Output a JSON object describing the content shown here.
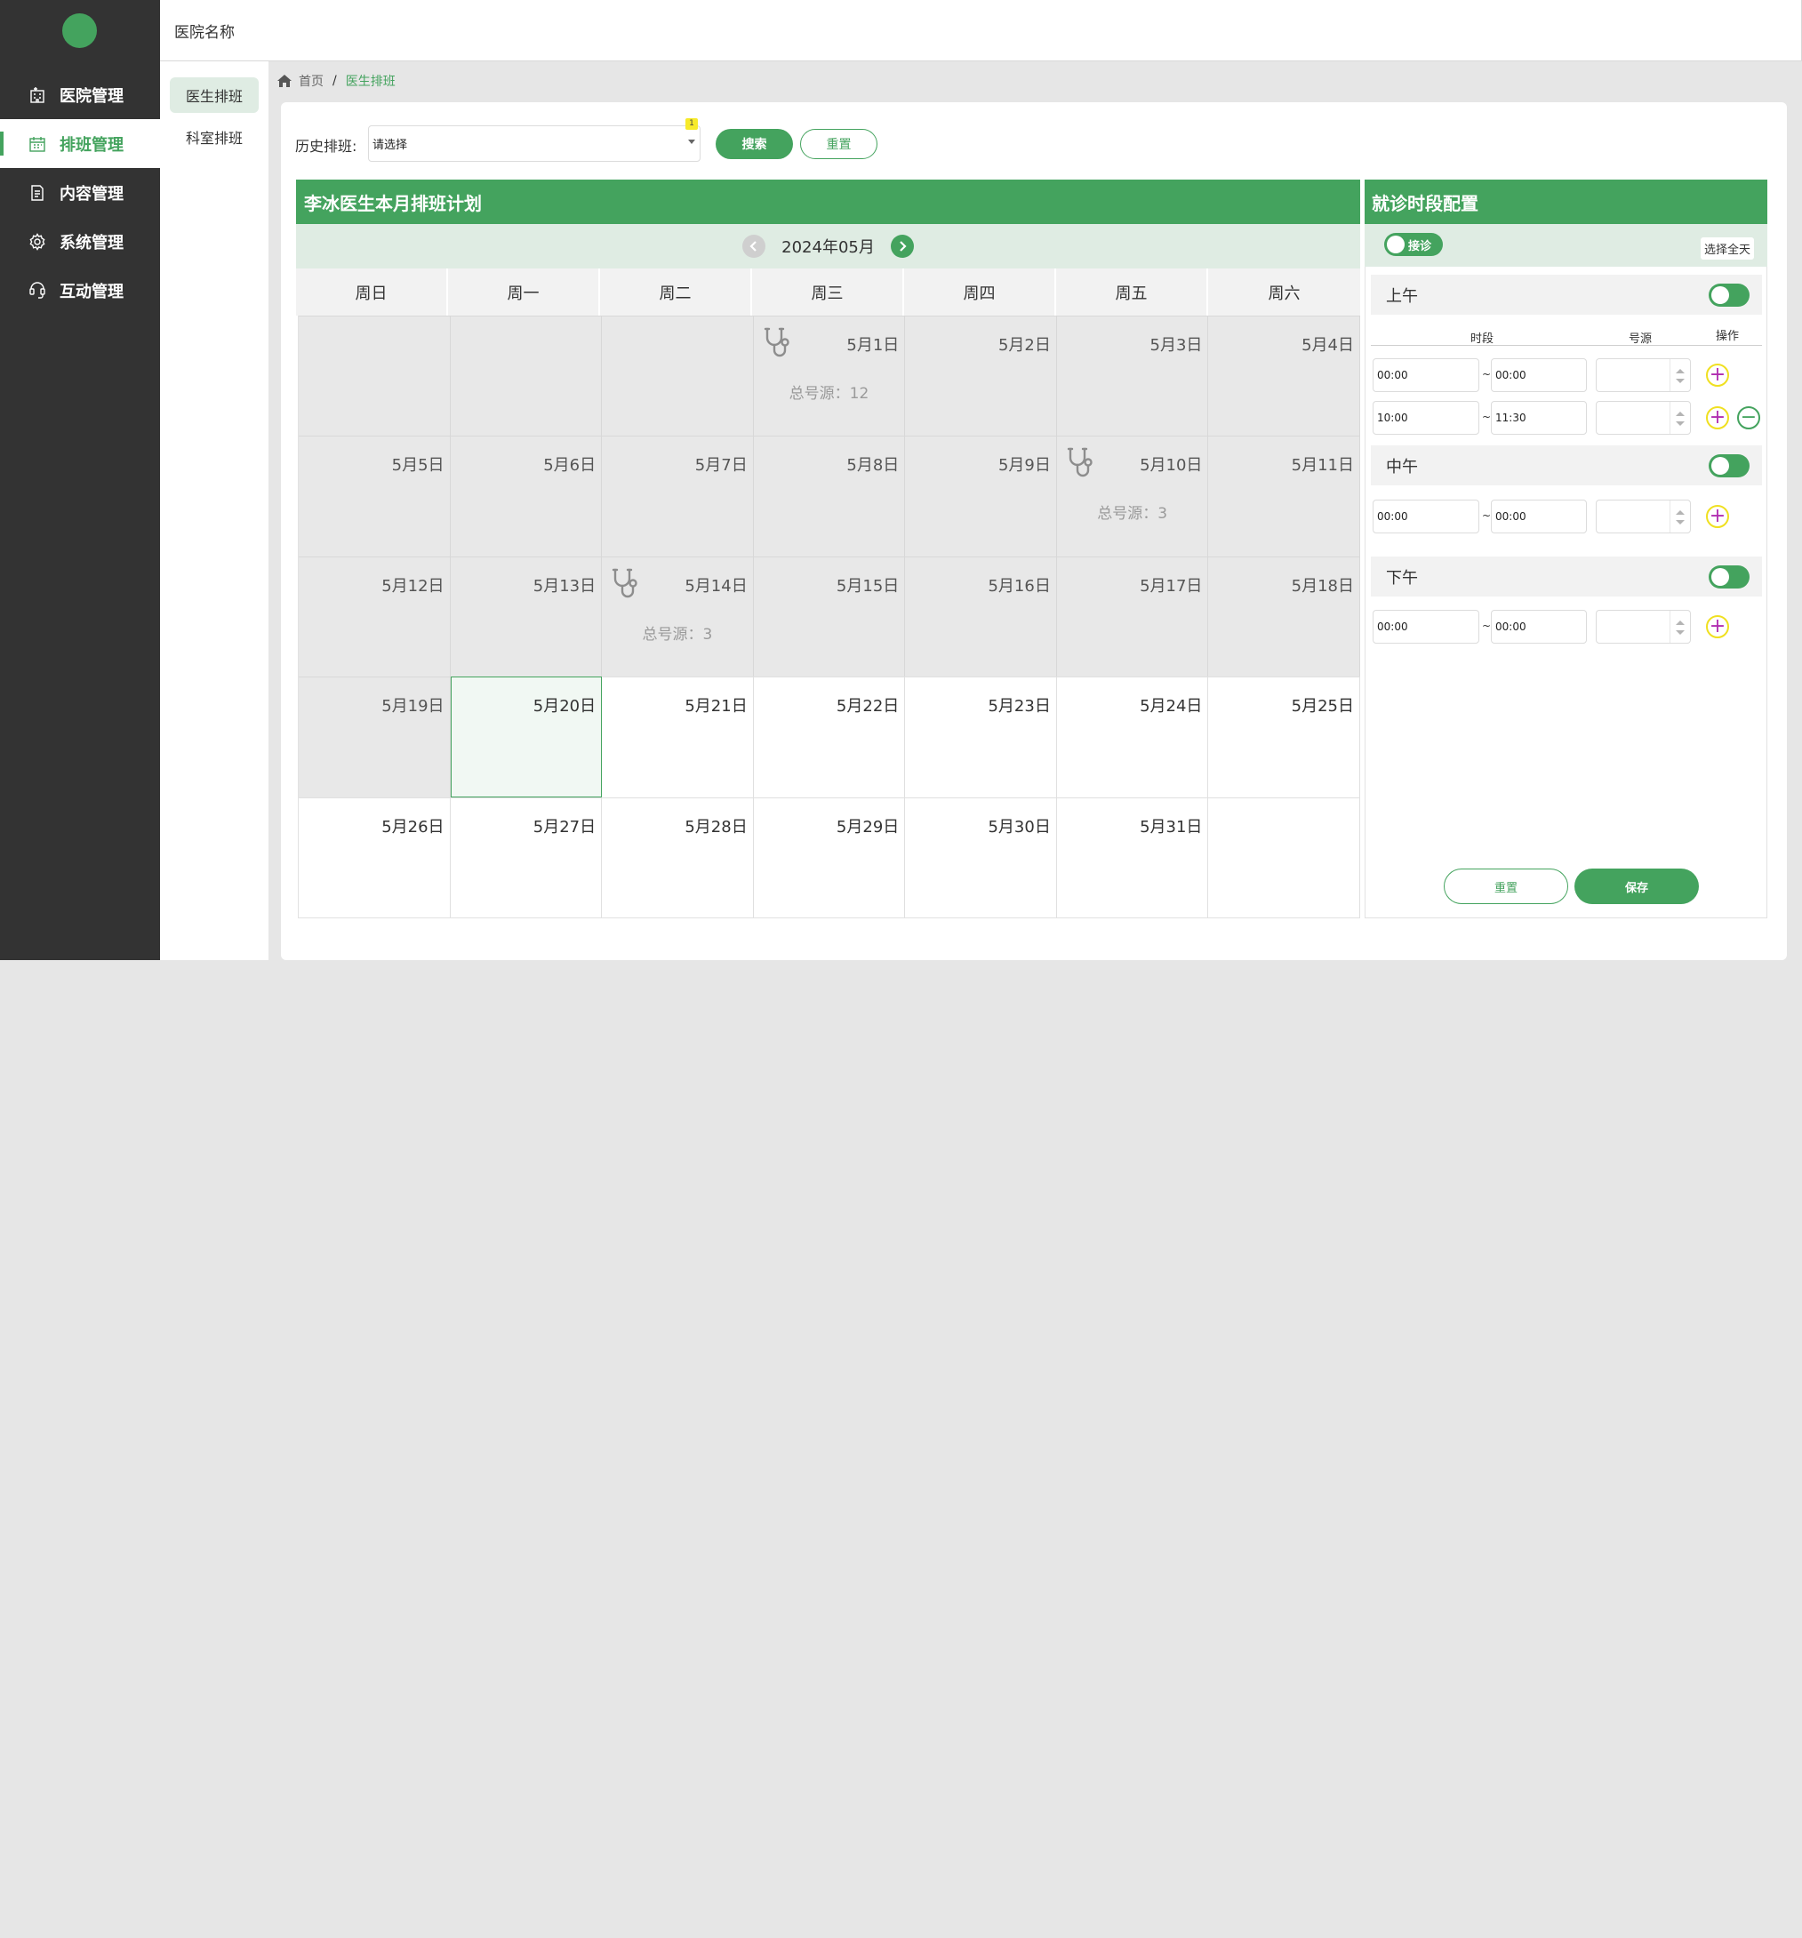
{
  "app": {
    "hospital_name": "医院名称"
  },
  "sidebar": {
    "items": [
      {
        "label": "医院管理",
        "icon": "hospital-icon"
      },
      {
        "label": "排班管理",
        "icon": "calendar-icon"
      },
      {
        "label": "内容管理",
        "icon": "document-icon"
      },
      {
        "label": "系统管理",
        "icon": "gear-icon"
      },
      {
        "label": "互动管理",
        "icon": "interaction-icon"
      }
    ],
    "active": "排班管理"
  },
  "subnav": {
    "items": [
      "医生排班",
      "科室排班"
    ],
    "active": "医生排班"
  },
  "breadcrumb": {
    "home": "首页",
    "separator": "/",
    "current": "医生排班"
  },
  "search": {
    "label": "历史排班:",
    "select_value": "请选择",
    "badge": "1",
    "search_button": "搜索",
    "reset_button": "重置"
  },
  "calendar": {
    "title": "李冰医生本月排班计划",
    "month": "2024年05月",
    "weekdays": [
      "周日",
      "周一",
      "周二",
      "周三",
      "周四",
      "周五",
      "周六"
    ],
    "cells": [
      {
        "date": "",
        "state": "past"
      },
      {
        "date": "",
        "state": "past"
      },
      {
        "date": "",
        "state": "past"
      },
      {
        "date": "5月1日",
        "state": "past",
        "scheduled": true,
        "total": "总号源：12"
      },
      {
        "date": "5月2日",
        "state": "past"
      },
      {
        "date": "5月3日",
        "state": "past"
      },
      {
        "date": "5月4日",
        "state": "past"
      },
      {
        "date": "5月5日",
        "state": "past"
      },
      {
        "date": "5月6日",
        "state": "past"
      },
      {
        "date": "5月7日",
        "state": "past"
      },
      {
        "date": "5月8日",
        "state": "past"
      },
      {
        "date": "5月9日",
        "state": "past"
      },
      {
        "date": "5月10日",
        "state": "past",
        "scheduled": true,
        "total": "总号源：3"
      },
      {
        "date": "5月11日",
        "state": "past"
      },
      {
        "date": "5月12日",
        "state": "past"
      },
      {
        "date": "5月13日",
        "state": "past"
      },
      {
        "date": "5月14日",
        "state": "past",
        "scheduled": true,
        "total": "总号源：3"
      },
      {
        "date": "5月15日",
        "state": "past"
      },
      {
        "date": "5月16日",
        "state": "past"
      },
      {
        "date": "5月17日",
        "state": "past"
      },
      {
        "date": "5月18日",
        "state": "past"
      },
      {
        "date": "5月19日",
        "state": "past"
      },
      {
        "date": "5月20日",
        "state": "today"
      },
      {
        "date": "5月21日",
        "state": "future"
      },
      {
        "date": "5月22日",
        "state": "future"
      },
      {
        "date": "5月23日",
        "state": "future"
      },
      {
        "date": "5月24日",
        "state": "future"
      },
      {
        "date": "5月25日",
        "state": "future"
      },
      {
        "date": "5月26日",
        "state": "future"
      },
      {
        "date": "5月27日",
        "state": "future"
      },
      {
        "date": "5月28日",
        "state": "future"
      },
      {
        "date": "5月29日",
        "state": "future"
      },
      {
        "date": "5月30日",
        "state": "future"
      },
      {
        "date": "5月31日",
        "state": "future"
      },
      {
        "date": "",
        "state": "future"
      }
    ]
  },
  "config": {
    "title": "就诊时段配置",
    "clinic_toggle_label": "接诊",
    "select_all_day": "选择全天",
    "col_period": "时段",
    "col_source": "号源",
    "col_action": "操作",
    "tilde": "~",
    "periods": [
      {
        "name": "上午",
        "enabled": true,
        "rows": [
          {
            "start": "00:00",
            "end": "00:00"
          },
          {
            "start": "10:00",
            "end": "11:30"
          }
        ]
      },
      {
        "name": "中午",
        "enabled": true,
        "rows": [
          {
            "start": "00:00",
            "end": "00:00"
          }
        ]
      },
      {
        "name": "下午",
        "enabled": true,
        "rows": [
          {
            "start": "00:00",
            "end": "00:00"
          }
        ]
      }
    ],
    "reset_button": "重置",
    "save_button": "保存"
  },
  "colors": {
    "primary": "#44a35e",
    "sidebar_bg": "#333333",
    "light_green": "#dfece3",
    "plus_ring": "#f0e020",
    "plus_sign": "#b02cb0"
  }
}
